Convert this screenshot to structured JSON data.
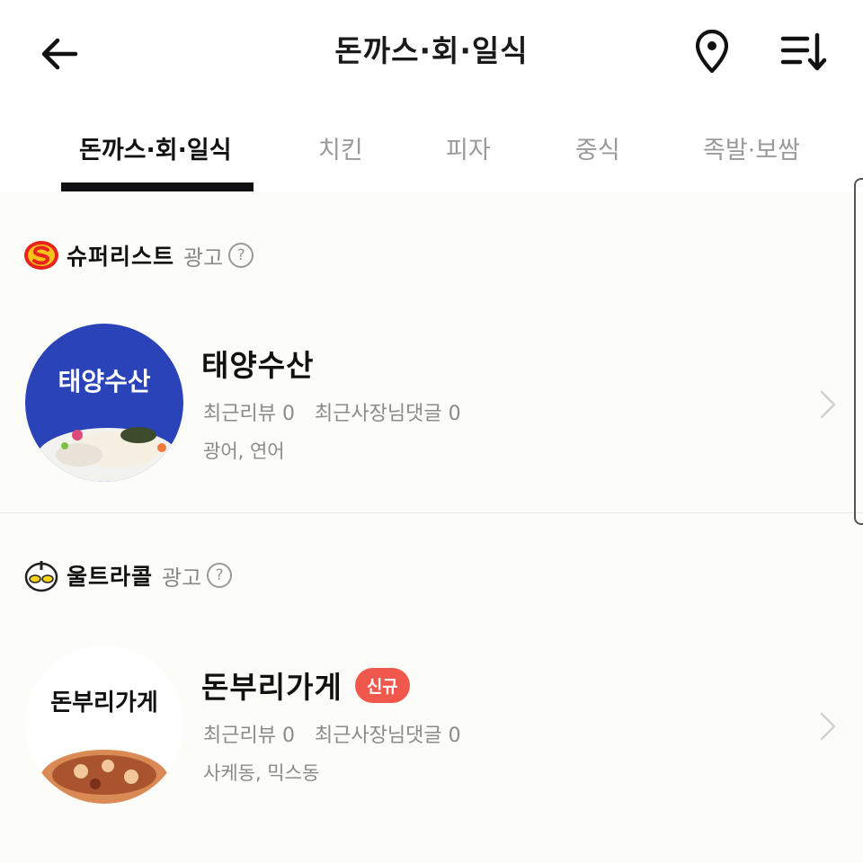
{
  "header": {
    "title": "돈까스·회·일식",
    "back_icon": "arrow-left-icon",
    "location_icon": "map-pin-icon",
    "sort_icon": "sort-list-icon"
  },
  "tabs": [
    {
      "label": "돈까스·회·일식",
      "active": true
    },
    {
      "label": "치킨",
      "active": false
    },
    {
      "label": "피자",
      "active": false
    },
    {
      "label": "중식",
      "active": false
    },
    {
      "label": "족발·보쌈",
      "active": false
    }
  ],
  "sections": [
    {
      "brand": "슈퍼리스트",
      "ad_label": "광고",
      "help_icon_text": "?",
      "store": {
        "name": "태양수산",
        "thumb_text": "태양수산",
        "stats": [
          "최근리뷰 0",
          "최근사장님댓글 0"
        ],
        "menu": "광어, 연어"
      }
    },
    {
      "brand": "울트라콜",
      "ad_label": "광고",
      "help_icon_text": "?",
      "store": {
        "name": "돈부리가게",
        "badge": "신규",
        "thumb_text": "돈부리가게",
        "stats": [
          "최근리뷰 0",
          "최근사장님댓글 0"
        ],
        "menu": "사케동, 믹스동"
      }
    }
  ],
  "colors": {
    "accent_badge": "#f1584d",
    "text_primary": "#111111",
    "text_secondary": "#8a8a8a",
    "content_bg": "#fcfcf8",
    "thumb1_bg": "#2a43b8"
  }
}
